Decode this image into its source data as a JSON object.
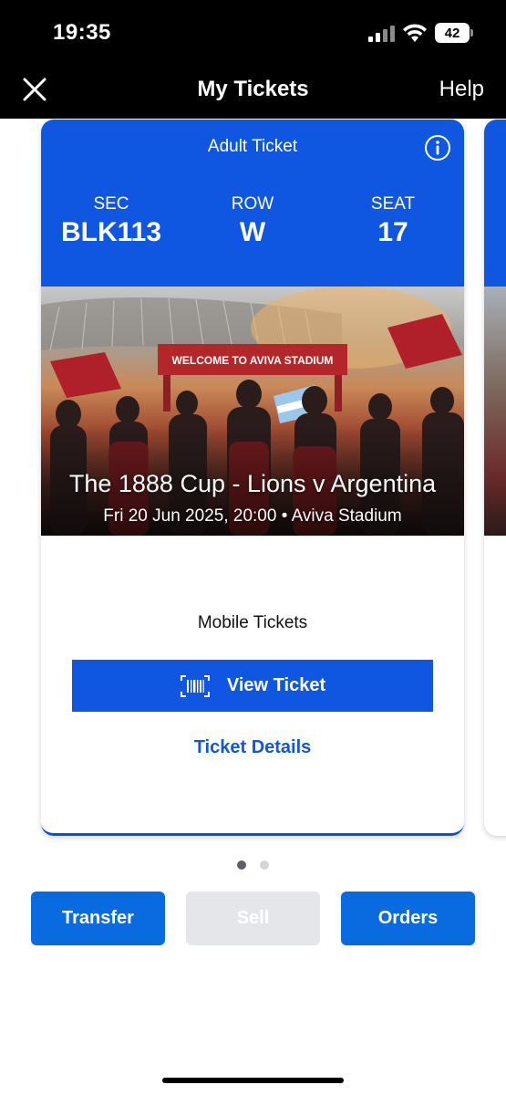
{
  "status_bar": {
    "time": "19:35",
    "battery": "42",
    "icons": [
      "signal-icon",
      "wifi-icon",
      "battery-icon"
    ]
  },
  "nav": {
    "close_icon": "close-icon",
    "title": "My Tickets",
    "help_label": "Help"
  },
  "ticket": {
    "type_label": "Adult Ticket",
    "info_icon": "info-icon",
    "section": {
      "label": "SEC",
      "value": "BLK113"
    },
    "row": {
      "label": "ROW",
      "value": "W"
    },
    "seat": {
      "label": "SEAT",
      "value": "17"
    },
    "event_title": "The 1888 Cup - Lions v Argentina",
    "event_subtitle": "Fri 20 Jun 2025, 20:00 • Aviva Stadium",
    "image_banner_text": "WELCOME TO AVIVA STADIUM",
    "mobile_label": "Mobile Tickets",
    "view_ticket_label": "View Ticket",
    "details_label": "Ticket Details"
  },
  "pagination": {
    "current": 1,
    "total": 2
  },
  "actions": {
    "transfer_label": "Transfer",
    "sell_label": "Sell",
    "orders_label": "Orders"
  },
  "colors": {
    "primary_blue": "#0f56e0",
    "action_blue": "#0a6ae0",
    "disabled_gray": "#e4e6e9",
    "topbar": "#000000"
  }
}
